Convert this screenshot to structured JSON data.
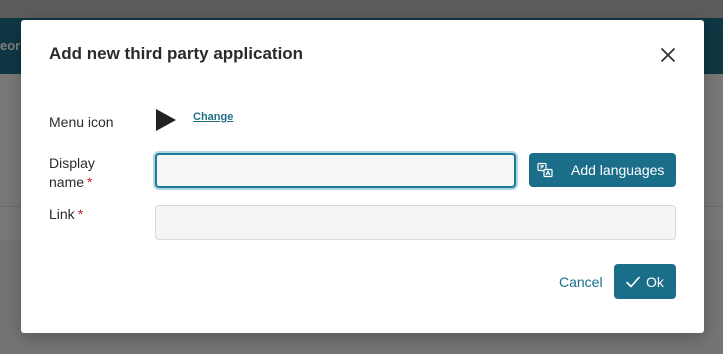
{
  "background": {
    "banner_text": "eor"
  },
  "dialog": {
    "title": "Add new third party application",
    "menu_icon_label": "Menu icon",
    "change_link": "Change",
    "display_name_label_line1": "Display",
    "display_name_label_line2": "name",
    "required_marker": "*",
    "display_name_value": "",
    "add_languages_label": "Add languages",
    "link_label": "Link",
    "link_value": "",
    "cancel_label": "Cancel",
    "ok_label": "Ok"
  },
  "colors": {
    "primary": "#1a6e8a",
    "required": "#c4262e",
    "focus_ring": "#1a7a99"
  },
  "icons": {
    "close": "close-icon",
    "menu_icon_preview": "play-icon",
    "languages": "translate-icon",
    "ok": "checkmark-icon"
  }
}
